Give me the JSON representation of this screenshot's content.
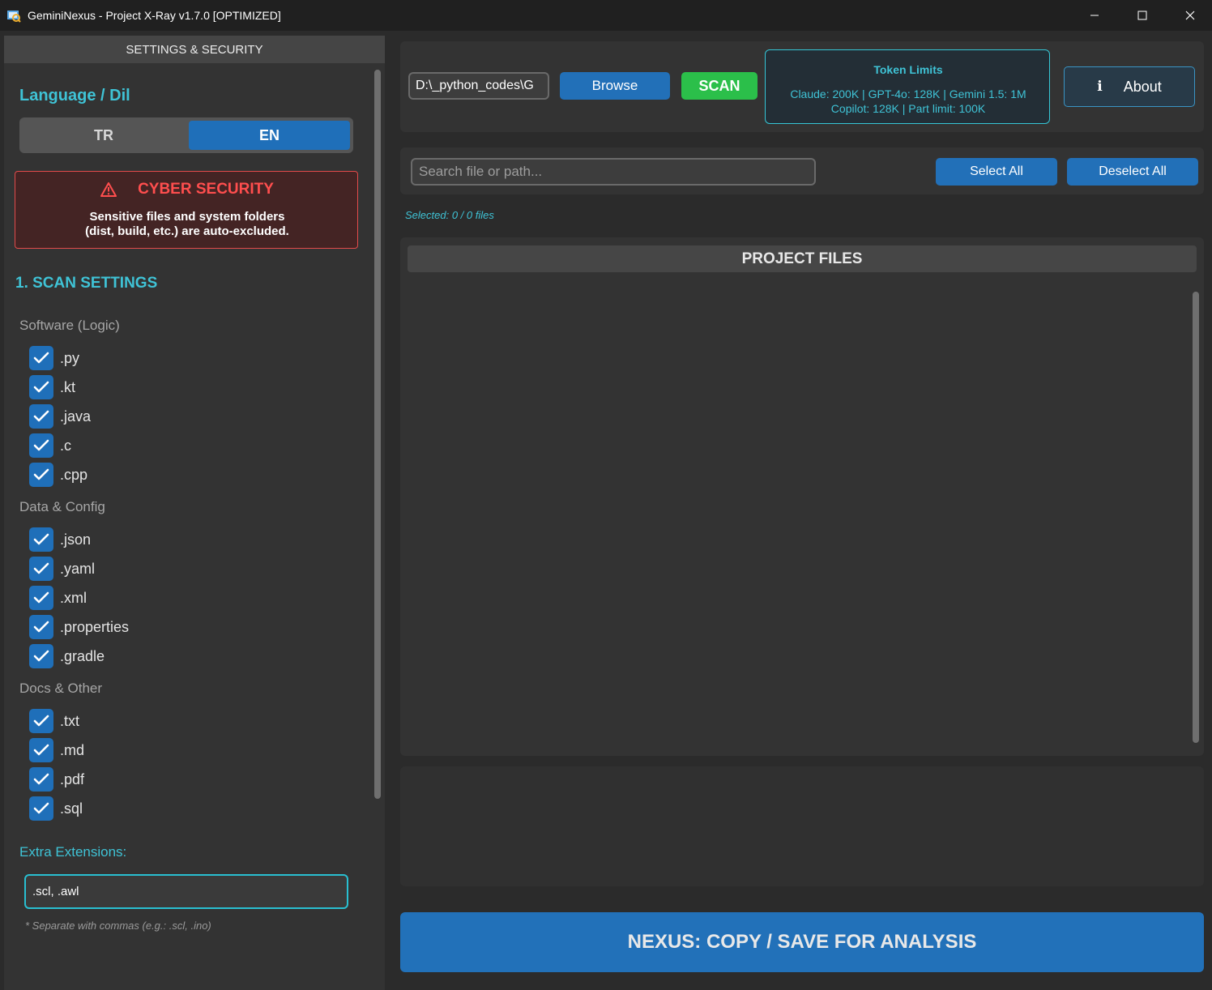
{
  "window": {
    "title": "GeminiNexus - Project X-Ray v1.7.0 [OPTIMIZED]",
    "controls": {
      "minimize": "—",
      "maximize": "☐",
      "close": "✕"
    }
  },
  "sidebar": {
    "header": "SETTINGS & SECURITY",
    "language": {
      "title": "Language / Dil",
      "options": [
        "TR",
        "EN"
      ],
      "selected": "EN"
    },
    "security": {
      "icon": "warning-triangle-icon",
      "title": "CYBER SECURITY",
      "line1": "Sensitive files and system folders",
      "line2": "(dist, build, etc.) are auto-excluded."
    },
    "scan_settings": {
      "title": "1. SCAN SETTINGS",
      "categories": [
        {
          "label": "Software (Logic)",
          "items": [
            ".py",
            ".kt",
            ".java",
            ".c",
            ".cpp"
          ]
        },
        {
          "label": "Data & Config",
          "items": [
            ".json",
            ".yaml",
            ".xml",
            ".properties",
            ".gradle"
          ]
        },
        {
          "label": "Docs & Other",
          "items": [
            ".txt",
            ".md",
            ".pdf",
            ".sql"
          ]
        }
      ],
      "all_checked": true
    },
    "extra": {
      "label": "Extra Extensions:",
      "value": ".scl, .awl",
      "hint": "* Separate with commas (e.g.: .scl, .ino)"
    }
  },
  "top": {
    "path_value": "D:\\_python_codes\\G",
    "browse_label": "Browse",
    "scan_label": "SCAN",
    "token": {
      "title": "Token Limits",
      "line1": "Claude: 200K  |  GPT-4o: 128K  |  Gemini 1.5: 1M",
      "line2": "Copilot: 128K  |  Part limit: 100K"
    },
    "about_icon": "i",
    "about_label": "About"
  },
  "search": {
    "placeholder": "Search file or path...",
    "select_all": "Select All",
    "deselect_all": "Deselect All",
    "selected_text": "Selected: 0 / 0 files"
  },
  "files": {
    "header": "PROJECT FILES"
  },
  "action": {
    "label": "NEXUS: COPY / SAVE FOR ANALYSIS"
  },
  "colors": {
    "accent_cyan": "#3fc3d6",
    "primary_blue": "#2270b8",
    "scan_green": "#2bbf4a",
    "danger_red": "#ff4e4e"
  }
}
